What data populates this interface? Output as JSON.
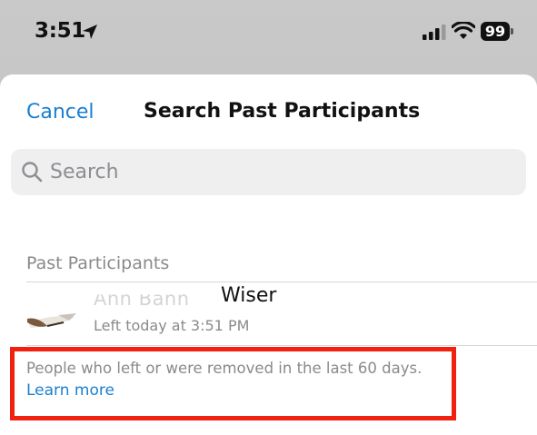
{
  "status_bar": {
    "time": "3:51",
    "battery": "99",
    "icons": [
      "location-arrow-icon",
      "cellular-signal-icon",
      "wifi-icon",
      "battery-icon"
    ]
  },
  "sheet": {
    "cancel_label": "Cancel",
    "title": "Search Past Participants"
  },
  "search": {
    "placeholder": "Search",
    "value": ""
  },
  "section": {
    "header": "Past Participants"
  },
  "participants": [
    {
      "name_visible": "Wiser",
      "subtitle": "Left today at 3:51 PM"
    }
  ],
  "footer": {
    "note": "People who left or were removed in the last 60 days.",
    "link_label": "Learn more"
  },
  "colors": {
    "accent": "#1a7fd1",
    "highlight": "#f0210f",
    "secondary_text": "#8a8a8e",
    "search_bg": "#efeff0"
  }
}
